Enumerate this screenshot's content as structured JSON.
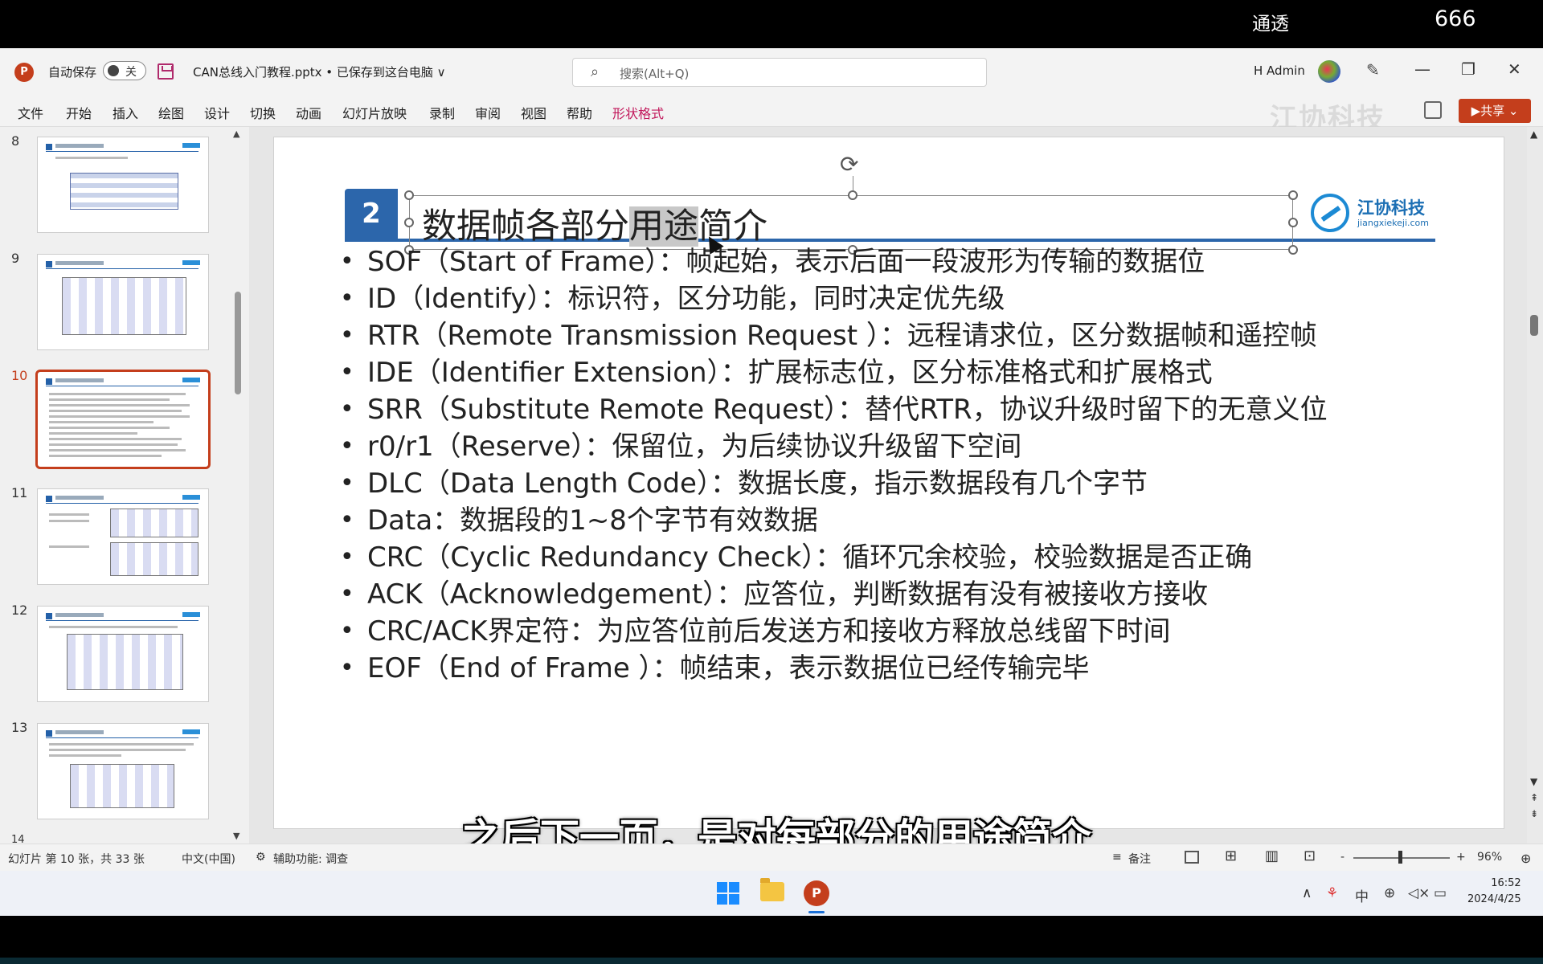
{
  "overlay": {
    "left_text": "通透",
    "right_text": "666"
  },
  "titlebar": {
    "app_logo": "P",
    "autosave_label": "自动保存",
    "autosave_state": "关",
    "document_title": "CAN总线入门教程.pptx • 已保存到这台电脑 ∨",
    "search_placeholder": "搜索(Alt+Q)",
    "user_name": "H Admin",
    "minimize": "—",
    "restore": "❐",
    "close": "✕"
  },
  "ribbon": {
    "tabs": [
      "文件",
      "开始",
      "插入",
      "绘图",
      "设计",
      "切换",
      "动画",
      "幻灯片放映",
      "录制",
      "审阅",
      "视图",
      "帮助",
      "形状格式"
    ],
    "watermark": "江协科技",
    "present_label": "▶共享 ⌄"
  },
  "thumbnails": {
    "numbers": [
      "8",
      "9",
      "10",
      "11",
      "12",
      "13",
      "14"
    ],
    "selected": "10"
  },
  "slide": {
    "number": "2",
    "title_before": "数据帧各部分",
    "title_highlight": "用途",
    "title_after": "简介",
    "logo_name": "江协科技",
    "logo_url": "jiangxiekeji.com",
    "bullets": [
      "SOF（Start of Frame）：帧起始，表示后面一段波形为传输的数据位",
      "ID（Identify）：标识符，区分功能，同时决定优先级",
      "RTR（Remote Transmission Request ）：远程请求位，区分数据帧和遥控帧",
      "IDE（Identifier Extension）：扩展标志位，区分标准格式和扩展格式",
      "SRR（Substitute Remote Request）：替代RTR，协议升级时留下的无意义位",
      "r0/r1（Reserve）：保留位，为后续协议升级留下空间",
      "DLC（Data Length Code）：数据长度，指示数据段有几个字节",
      "Data：数据段的1~8个字节有效数据",
      "CRC（Cyclic Redundancy Check）：循环冗余校验，校验数据是否正确",
      "ACK（Acknowledgement）：应答位，判断数据有没有被接收方接收",
      "CRC/ACK界定符：为应答位前后发送方和接收方释放总线留下时间",
      "EOF（End of Frame ）：帧结束，表示数据位已经传输完毕"
    ]
  },
  "subtitle": "之后下一页，是对每部分的用途简介",
  "statusbar": {
    "slide_info": "幻灯片 第 10 张，共 33 张",
    "language": "中文(中国)",
    "accessibility": "辅助功能: 调查",
    "notes": "备注",
    "zoom_minus": "-",
    "zoom_plus": "+",
    "zoom": "96%",
    "zoom_level": 0.96
  },
  "taskbar": {
    "ppt_label": "P",
    "tray_up": "∧",
    "ime": "中",
    "time": "16:52",
    "date": "2024/4/25"
  },
  "colors": {
    "accent": "#c43e1c",
    "slide_blue": "#2c66ab",
    "logo_blue": "#1c8ad4",
    "shape_format_tab": "#c2185b"
  }
}
